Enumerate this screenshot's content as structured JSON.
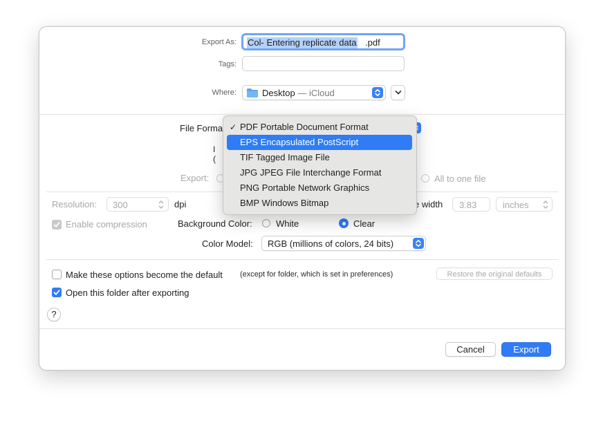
{
  "export_as": {
    "label": "Export As:",
    "value_selected": "Col- Entering replicate data",
    "value_ext": ".pdf"
  },
  "tags": {
    "label": "Tags:",
    "placeholder": ""
  },
  "where": {
    "label": "Where:",
    "value": "Desktop",
    "sep": " — ",
    "location": "iCloud",
    "folder_icon": "folder-icon"
  },
  "file_format": {
    "label": "File Format:",
    "label_visible": "File Forma"
  },
  "format_menu": {
    "items": [
      {
        "label": "PDF Portable Document Format",
        "checked": true
      },
      {
        "label": "EPS Encapsulated PostScript",
        "highlighted": true
      },
      {
        "label": "TIF Tagged Image File"
      },
      {
        "label": "JPG JPEG File Interchange Format"
      },
      {
        "label": "PNG Portable Network Graphics"
      },
      {
        "label": "BMP Windows Bitmap"
      }
    ],
    "check_mark": "✓"
  },
  "export_scope": {
    "label": "Export:",
    "all_to_one": "All to one file"
  },
  "hidden_partials": {
    "p1": "I",
    "p2": "("
  },
  "resolution": {
    "label": "Resolution:",
    "value": "300",
    "unit": "dpi"
  },
  "image_width": {
    "label": "e width",
    "value": "3.83",
    "unit": "inches"
  },
  "compression": {
    "label": "Enable compression",
    "checked": true
  },
  "background_color": {
    "label": "Background Color:",
    "white": "White",
    "clear": "Clear",
    "selected": "clear"
  },
  "color_model": {
    "label": "Color Model:",
    "value": "RGB (millions of colors, 24 bits)"
  },
  "defaults": {
    "make_default": "Make these options become the default",
    "note": "(except for folder, which is set in preferences)",
    "restore": "Restore the original defaults"
  },
  "open_folder": {
    "label": "Open this folder after exporting",
    "checked": true
  },
  "help": {
    "label": "?"
  },
  "buttons": {
    "cancel": "Cancel",
    "export": "Export"
  },
  "colors": {
    "accent": "#2f7cf6",
    "selection": "#b3d1fb",
    "focus_ring": "#6ea5f5"
  }
}
